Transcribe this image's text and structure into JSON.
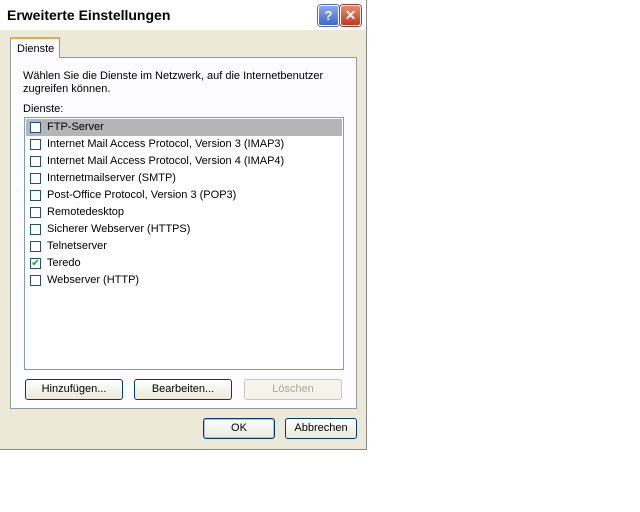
{
  "window": {
    "title": "Erweiterte Einstellungen",
    "help_glyph": "?",
    "close_glyph": "✕"
  },
  "tab": {
    "label": "Dienste"
  },
  "description": "Wählen Sie die Dienste im Netzwerk, auf die Internetbenutzer zugreifen können.",
  "list_label": "Dienste:",
  "services": [
    {
      "label": "FTP-Server",
      "checked": false,
      "selected": true
    },
    {
      "label": "Internet Mail Access Protocol, Version 3 (IMAP3)",
      "checked": false
    },
    {
      "label": "Internet Mail Access Protocol, Version 4 (IMAP4)",
      "checked": false
    },
    {
      "label": "Internetmailserver (SMTP)",
      "checked": false
    },
    {
      "label": "Post-Office Protocol, Version 3 (POP3)",
      "checked": false
    },
    {
      "label": "Remotedesktop",
      "checked": false
    },
    {
      "label": "Sicherer Webserver (HTTPS)",
      "checked": false
    },
    {
      "label": "Telnetserver",
      "checked": false
    },
    {
      "label": "Teredo",
      "checked": true
    },
    {
      "label": "Webserver (HTTP)",
      "checked": false
    }
  ],
  "buttons": {
    "add": "Hinzufügen...",
    "edit": "Bearbeiten...",
    "delete": "Löschen",
    "ok": "OK",
    "cancel": "Abbrechen"
  }
}
